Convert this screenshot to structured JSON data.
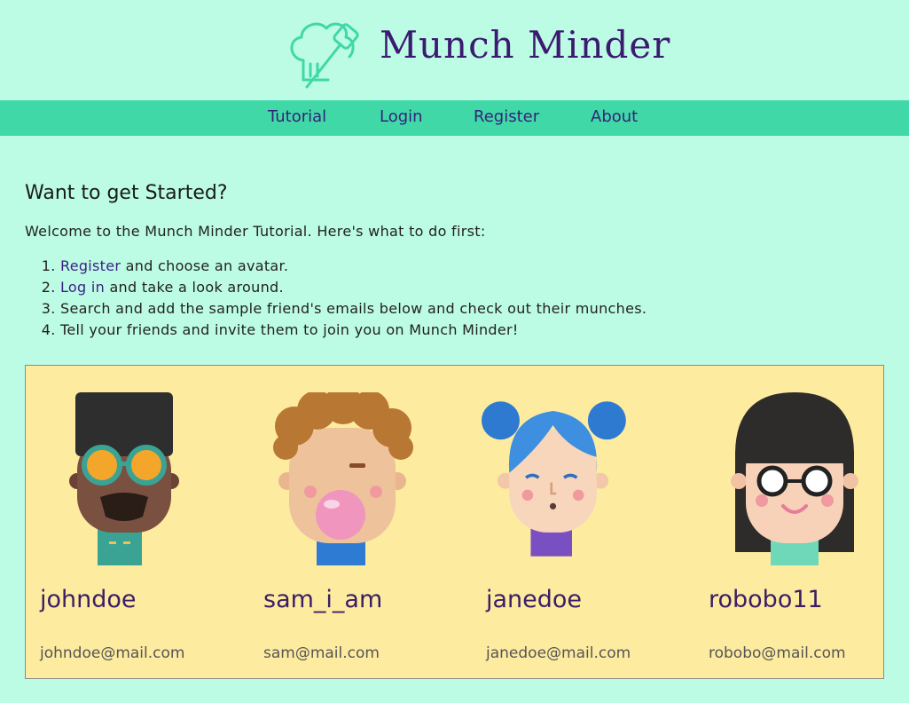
{
  "app": {
    "brand": "Munch Minder"
  },
  "nav": {
    "items": [
      "Tutorial",
      "Login",
      "Register",
      "About"
    ]
  },
  "page": {
    "heading": "Want to get Started?",
    "intro": "Welcome to the Munch Minder Tutorial. Here's what to do first:",
    "steps": [
      {
        "link": "Register",
        "text": " and choose an avatar."
      },
      {
        "link": "Log in",
        "text": " and take a look around."
      },
      {
        "link": "",
        "text": "Search and add the sample friend's emails below and check out their munches."
      },
      {
        "link": "",
        "text": "Tell your friends and invite them to join you on Munch Minder!"
      }
    ]
  },
  "friends": [
    {
      "username": "johndoe",
      "email": "johndoe@mail.com",
      "avatar": "avatar-man-glasses-icon"
    },
    {
      "username": "sam_i_am",
      "email": "sam@mail.com",
      "avatar": "avatar-boy-bubblegum-icon"
    },
    {
      "username": "janedoe",
      "email": "janedoe@mail.com",
      "avatar": "avatar-girl-blue-hair-icon"
    },
    {
      "username": "robobo11",
      "email": "robobo@mail.com",
      "avatar": "avatar-woman-glasses-icon"
    }
  ],
  "colors": {
    "background": "#bcfbe4",
    "nav": "#41d8a8",
    "brand": "#3d1a72",
    "card_panel": "#fdeba0"
  }
}
